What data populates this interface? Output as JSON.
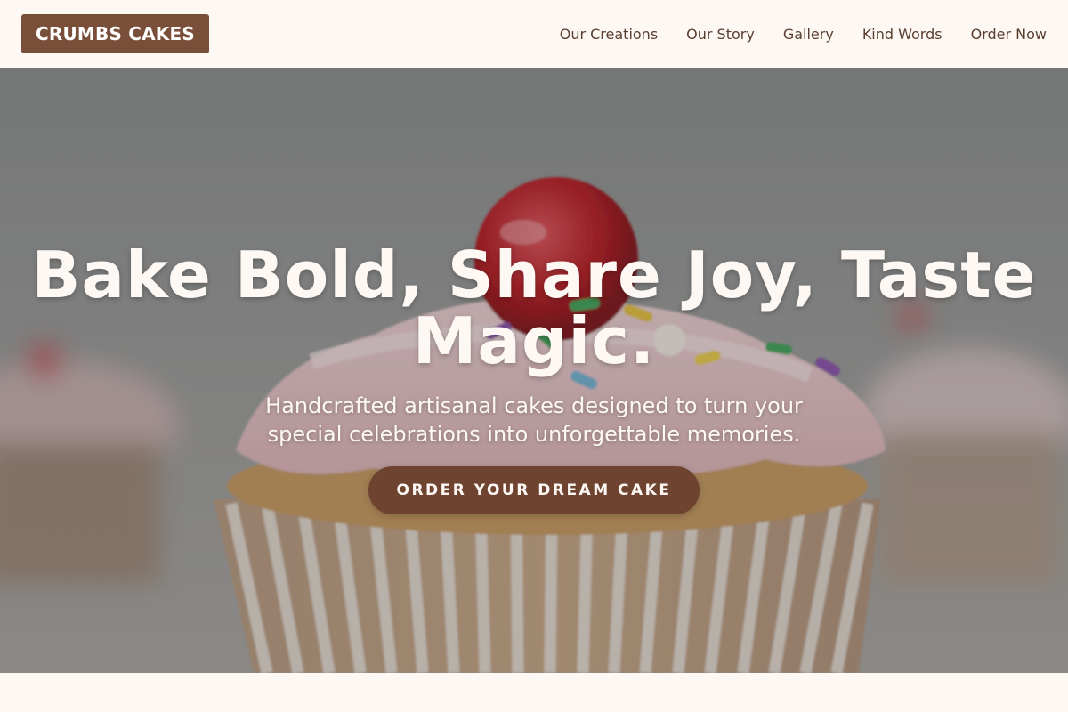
{
  "header": {
    "brand": "CRUMBS CAKES",
    "nav": [
      {
        "label": "Our Creations"
      },
      {
        "label": "Our Story"
      },
      {
        "label": "Gallery"
      },
      {
        "label": "Kind Words"
      },
      {
        "label": "Order Now"
      }
    ]
  },
  "hero": {
    "title": "Bake Bold, Share Joy, Taste Magic.",
    "subtitle": "Handcrafted artisanal cakes designed to turn your special celebrations into unforgettable memories.",
    "cta_label": "ORDER YOUR DREAM CAKE",
    "background_icon": "cupcake-photo"
  },
  "colors": {
    "brand_bg": "#7a4f3a",
    "cta_bg": "#6e4330",
    "page_bg": "#fdf8f3",
    "nav_text": "#5a3e30"
  }
}
